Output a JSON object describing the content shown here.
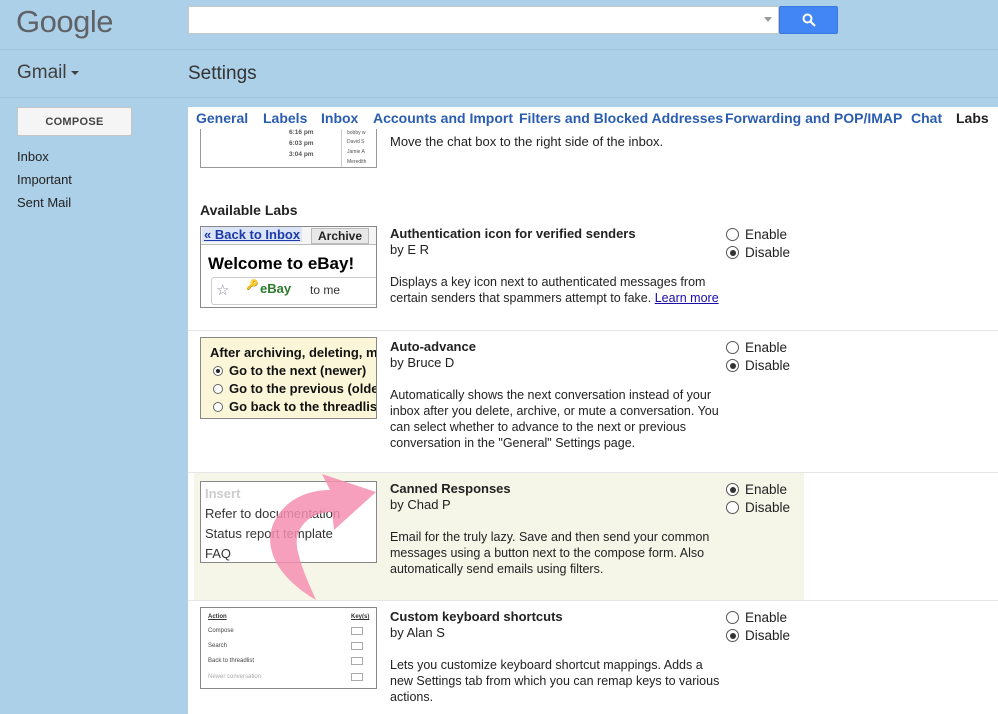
{
  "header": {
    "logo": "Google",
    "search_placeholder": "",
    "search_value": ""
  },
  "brand": {
    "app": "Gmail",
    "page_title": "Settings"
  },
  "sidebar": {
    "compose": "COMPOSE",
    "items": [
      "Inbox",
      "Important",
      "Sent Mail"
    ]
  },
  "tabs": [
    {
      "label": "General",
      "active": false
    },
    {
      "label": "Labels",
      "active": false
    },
    {
      "label": "Inbox",
      "active": false
    },
    {
      "label": "Accounts and Import",
      "active": false
    },
    {
      "label": "Filters and Blocked Addresses",
      "active": false
    },
    {
      "label": "Forwarding and POP/IMAP",
      "active": false
    },
    {
      "label": "Chat",
      "active": false
    },
    {
      "label": "Labs",
      "active": true
    }
  ],
  "chat_preview": {
    "text": "Move the chat box to the right side of the inbox.",
    "times": [
      "6:16 pm",
      "6:03 pm",
      "3:04 pm"
    ],
    "names": [
      "bobby w",
      "David S",
      "Jamie A",
      "Meredith"
    ]
  },
  "section_title": "Available Labs",
  "labs": [
    {
      "title": "Authentication icon for verified senders",
      "author": "by E R",
      "description": "Displays a key icon next to authenticated messages from certain senders that spammers attempt to fake.",
      "link": "Learn more",
      "enable_label": "Enable",
      "disable_label": "Disable",
      "selected": "Disable",
      "thumb": {
        "back": "« Back to Inbox",
        "archive": "Archive",
        "welcome": "Welcome to eBay!",
        "sender": "eBay",
        "to": "to me"
      }
    },
    {
      "title": "Auto-advance",
      "author": "by Bruce D",
      "description": "Automatically shows the next conversation instead of your inbox after you delete, archive, or mute a conversation. You can select whether to advance to the next or previous conversation in the \"General\" Settings page.",
      "enable_label": "Enable",
      "disable_label": "Disable",
      "selected": "Disable",
      "thumb": {
        "heading": "After archiving, deleting, m",
        "opt1": "Go to the next (newer)",
        "opt2": "Go to the previous (olde",
        "opt3": "Go back to the threadlis"
      }
    },
    {
      "title": "Canned Responses",
      "author": "by Chad P",
      "description": "Email for the truly lazy. Save and then send your common messages using a button next to the compose form. Also automatically send emails using filters.",
      "enable_label": "Enable",
      "disable_label": "Disable",
      "selected": "Enable",
      "thumb": {
        "insert": "Insert",
        "l1": "Refer to documentation",
        "l2": "Status report template",
        "l3": "FAQ"
      }
    },
    {
      "title": "Custom keyboard shortcuts",
      "author": "by Alan S",
      "description": "Lets you customize keyboard shortcut mappings. Adds a new Settings tab from which you can remap keys to various actions.",
      "enable_label": "Enable",
      "disable_label": "Disable",
      "selected": "Disable",
      "thumb": {
        "h1": "Action",
        "h2": "Key(s)",
        "r1": "Compose",
        "r2": "Search",
        "r3": "Back to threadlist",
        "r4": "Newer conversation"
      }
    }
  ],
  "colors": {
    "background": "#add0e9",
    "link": "#2a5db0",
    "highlight": "#f5f6e8",
    "arrow": "#f48fb1",
    "search_button": "#4285f4"
  }
}
